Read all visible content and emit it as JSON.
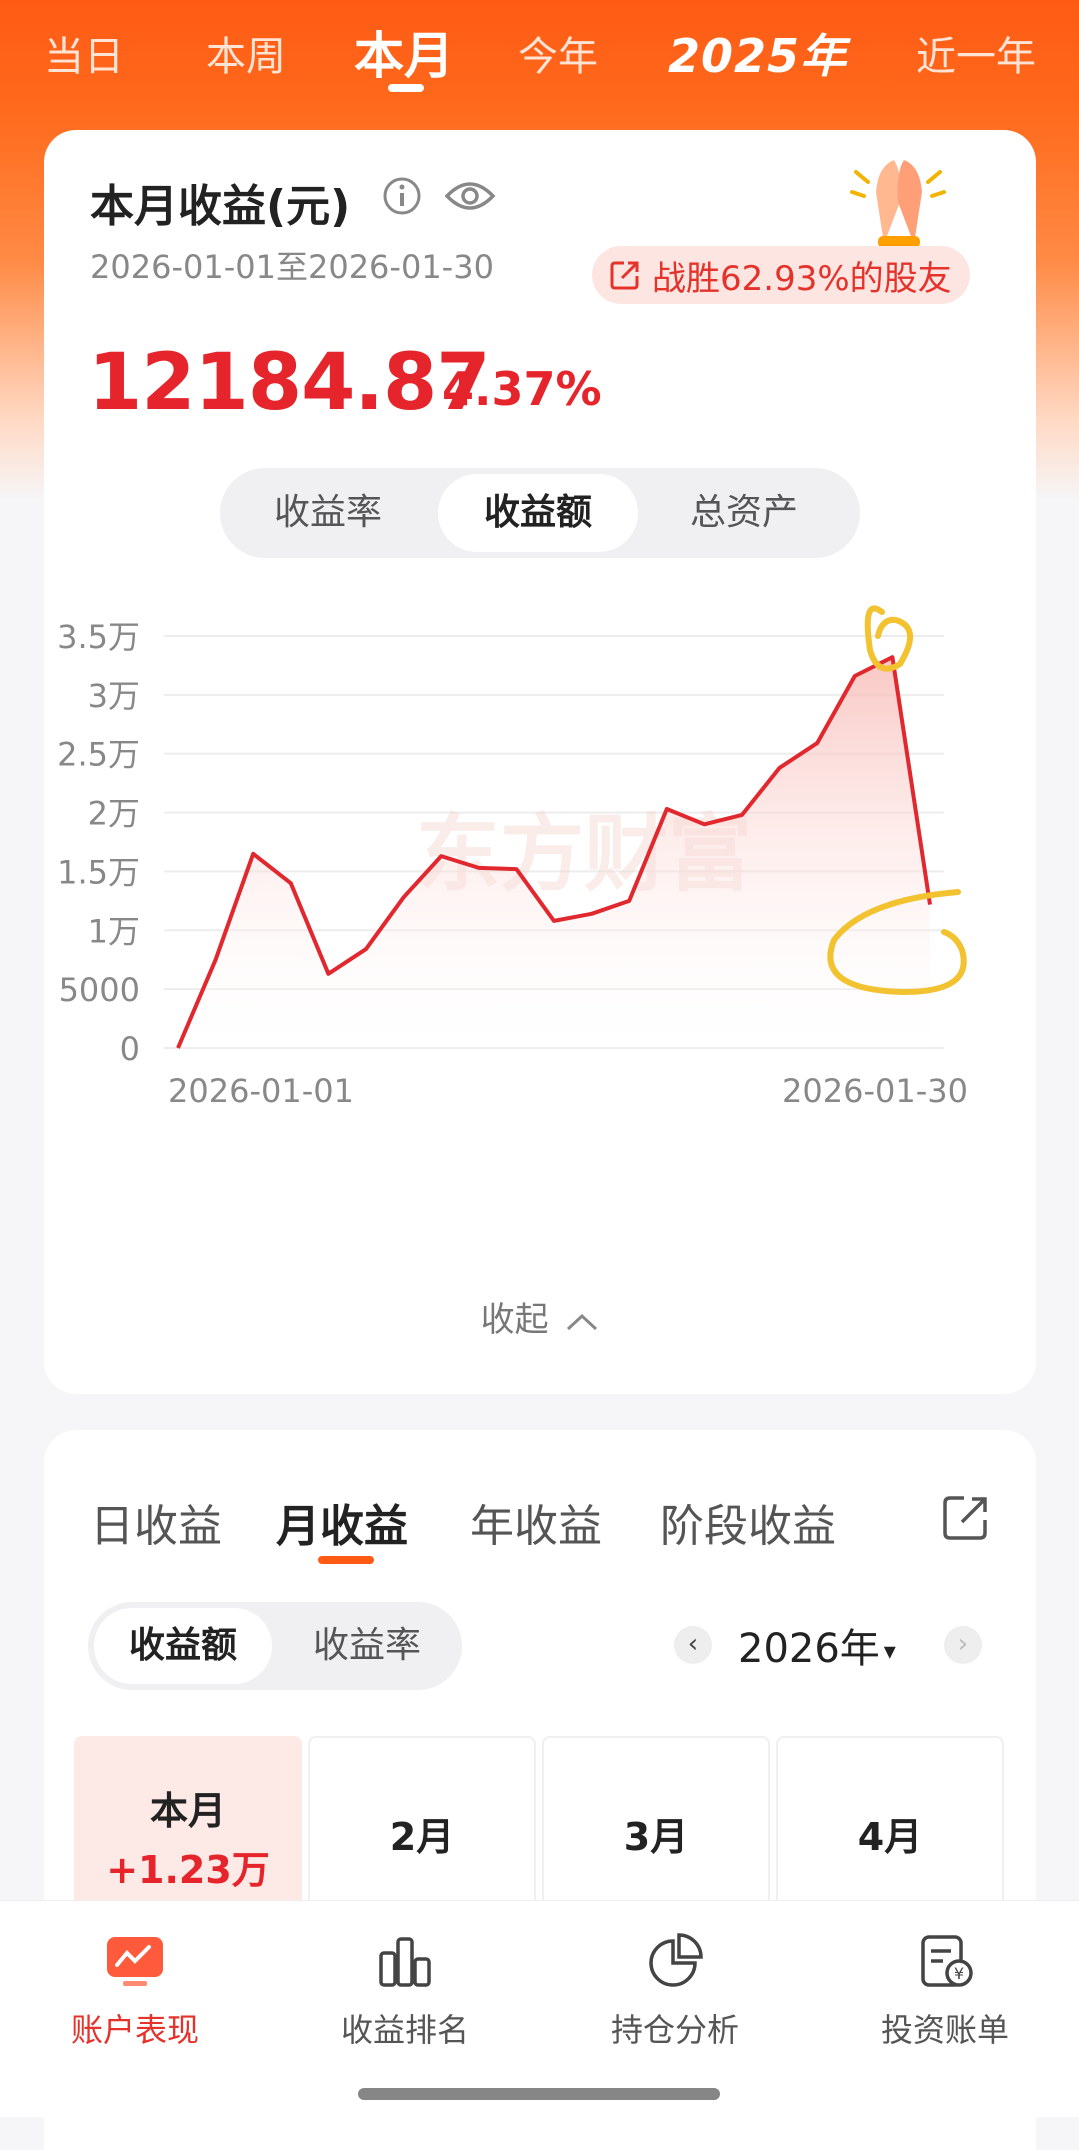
{
  "top_tabs": [
    "当日",
    "本周",
    "本月",
    "今年",
    "2025年",
    "近一年"
  ],
  "active_tab": "本月",
  "summary": {
    "title": "本月收益(元)",
    "date_range": "2026-01-01至2026-01-30",
    "beat_text": "战胜62.93%的股友",
    "amount": "12184.87",
    "percent": "4.37%"
  },
  "metric_toggle": {
    "options": [
      "收益率",
      "收益额",
      "总资产"
    ],
    "selected": "收益额"
  },
  "chart_data": {
    "type": "line",
    "y_tick_labels": [
      "3.5万",
      "3万",
      "2.5万",
      "2万",
      "1.5万",
      "1万",
      "5000",
      "0"
    ],
    "ylim": [
      0,
      35000
    ],
    "x_tick_labels": [
      "2026-01-01",
      "2026-01-30"
    ],
    "watermark": "东方财富",
    "series": [
      {
        "values": [
          0,
          7500,
          16500,
          14000,
          6300,
          8400,
          12800,
          16300,
          15300,
          15200,
          10800,
          11400,
          12500,
          20300,
          19000,
          19800,
          23800,
          25900,
          31600,
          33200,
          12184.87
        ]
      }
    ],
    "grid": true
  },
  "collapse_label": "收起",
  "period_tabs": [
    "日收益",
    "月收益",
    "年收益",
    "阶段收益"
  ],
  "period_selected": "月收益",
  "metric_toggle2": {
    "options": [
      "收益额",
      "收益率"
    ],
    "selected": "收益额"
  },
  "year_label": "2026年",
  "months": [
    {
      "label": "本月",
      "value": "+1.23万"
    },
    {
      "label": "2月",
      "value": ""
    },
    {
      "label": "3月",
      "value": ""
    },
    {
      "label": "4月",
      "value": ""
    }
  ],
  "bottom_nav": [
    "账户表现",
    "收益排名",
    "持仓分析",
    "投资账单"
  ],
  "colors": {
    "accent": "#ff5a14",
    "gain": "#e5242b",
    "line": "#e0282e",
    "annotation": "#f2c230"
  }
}
